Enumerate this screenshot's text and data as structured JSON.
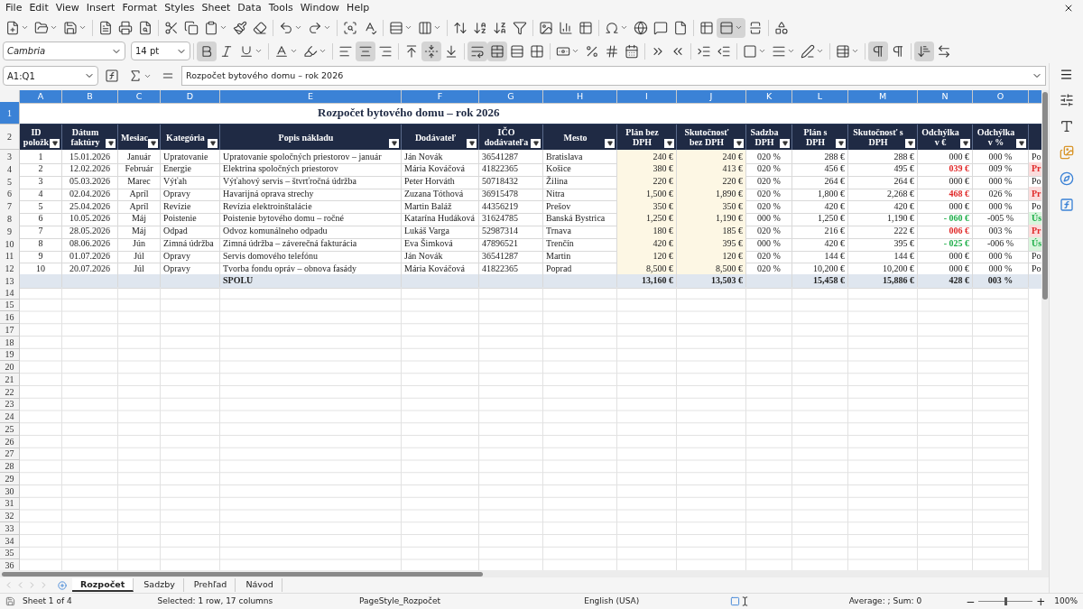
{
  "menu": [
    "File",
    "Edit",
    "View",
    "Insert",
    "Format",
    "Styles",
    "Sheet",
    "Data",
    "Tools",
    "Window",
    "Help"
  ],
  "formatting": {
    "font_name": "Cambria",
    "font_size": "14 pt",
    "pressed": {
      "bold": true,
      "italic": false,
      "underline": false,
      "align_left": false,
      "align_center": true,
      "align_right": false,
      "align_top": false,
      "align_middle": true,
      "align_bottom": false,
      "wrap": true,
      "merge": true,
      "unmerge": false,
      "ltr": true,
      "rtl": false,
      "stacked": true
    }
  },
  "formula_bar": {
    "name_box": "A1:Q1",
    "content": "Rozpočet bytového domu – rok 2026"
  },
  "columns": [
    {
      "label": "A",
      "selected": true
    },
    {
      "label": "B",
      "selected": true
    },
    {
      "label": "C",
      "selected": true
    },
    {
      "label": "D",
      "selected": true
    },
    {
      "label": "E",
      "selected": true
    },
    {
      "label": "F",
      "selected": true
    },
    {
      "label": "G",
      "selected": true
    },
    {
      "label": "H",
      "selected": true
    },
    {
      "label": "I",
      "selected": true
    },
    {
      "label": "J",
      "selected": true
    },
    {
      "label": "K",
      "selected": true
    },
    {
      "label": "L",
      "selected": true
    },
    {
      "label": "M",
      "selected": true
    },
    {
      "label": "N",
      "selected": true
    },
    {
      "label": "O",
      "selected": true
    },
    {
      "selected": true
    }
  ],
  "row_numbers": [
    {
      "label": "1",
      "selected": true
    },
    {
      "label": "2",
      "selected": false
    },
    {
      "label": "3",
      "selected": false
    },
    {
      "label": "4",
      "selected": false
    },
    {
      "label": "5",
      "selected": false
    },
    {
      "label": "6",
      "selected": false
    },
    {
      "label": "7",
      "selected": false
    },
    {
      "label": "8",
      "selected": false
    },
    {
      "label": "9",
      "selected": false
    },
    {
      "label": "10",
      "selected": false
    },
    {
      "label": "11",
      "selected": false
    },
    {
      "label": "12",
      "selected": false
    },
    {
      "label": "13",
      "selected": false
    },
    {
      "label": "14",
      "selected": false
    },
    {
      "label": "15",
      "selected": false
    },
    {
      "label": "16",
      "selected": false
    },
    {
      "label": "17",
      "selected": false
    },
    {
      "label": "18",
      "selected": false
    },
    {
      "label": "19",
      "selected": false
    },
    {
      "label": "20",
      "selected": false
    },
    {
      "label": "21",
      "selected": false
    },
    {
      "label": "22",
      "selected": false
    },
    {
      "label": "23",
      "selected": false
    },
    {
      "label": "24",
      "selected": false
    },
    {
      "label": "25",
      "selected": false
    },
    {
      "label": "26",
      "selected": false
    },
    {
      "label": "27",
      "selected": false
    },
    {
      "label": "28",
      "selected": false
    },
    {
      "label": "29",
      "selected": false
    },
    {
      "label": "30",
      "selected": false
    },
    {
      "label": "31",
      "selected": false
    },
    {
      "label": "32",
      "selected": false
    },
    {
      "label": "33",
      "selected": false
    },
    {
      "label": "34",
      "selected": false
    },
    {
      "label": "35",
      "selected": false
    },
    {
      "label": "36",
      "selected": false
    }
  ],
  "title": "Rozpočet bytového domu – rok 2026",
  "headers": [
    "ID položk",
    "Dátum faktúry",
    "Mesiac",
    "Kategória",
    "Popis nákladu",
    "Dodávateľ",
    "IČO dodávateľa",
    "Mesto",
    "Plán bez DPH",
    "Skutočnosť bez DPH",
    "Sadzba DPH",
    "Plán s DPH",
    "Skutočnosť s DPH",
    "Odchýlka v €",
    "Odchýlka v %"
  ],
  "rows": [
    {
      "kind": "even",
      "cells": [
        "1",
        "15.01.2026",
        "Január",
        "Upratovanie",
        "Upratovanie spoločných priestorov – január",
        "Ján Novák",
        "36541287",
        "Bratislava",
        "240 €",
        "240 €",
        "020 %",
        "288 €",
        "288 €",
        "000 €",
        "000 %",
        "Po"
      ]
    },
    {
      "kind": "over",
      "cells": [
        "2",
        "12.02.2026",
        "Február",
        "Energie",
        "Elektrina spoločných priestorov",
        "Mária Kováčová",
        "41822365",
        "Košice",
        "380 €",
        "413 €",
        "020 %",
        "456 €",
        "495 €",
        "039 €",
        "009 %",
        "Pr"
      ]
    },
    {
      "kind": "even",
      "cells": [
        "3",
        "05.03.2026",
        "Marec",
        "Výťah",
        "Výťahový servis – štvrťročná údržba",
        "Peter Horváth",
        "50718432",
        "Žilina",
        "220 €",
        "220 €",
        "020 %",
        "264 €",
        "264 €",
        "000 €",
        "000 %",
        "Po"
      ]
    },
    {
      "kind": "over",
      "cells": [
        "4",
        "02.04.2026",
        "Apríl",
        "Opravy",
        "Havarijná oprava strechy",
        "Zuzana Tóthová",
        "36915478",
        "Nitra",
        "1,500 €",
        "1,890 €",
        "020 %",
        "1,800 €",
        "2,268 €",
        "468 €",
        "026 %",
        "Pr"
      ]
    },
    {
      "kind": "even",
      "cells": [
        "5",
        "25.04.2026",
        "Apríl",
        "Revízie",
        "Revízia elektroinštalácie",
        "Martin Baláž",
        "44356219",
        "Prešov",
        "350 €",
        "350 €",
        "020 %",
        "420 €",
        "420 €",
        "000 €",
        "000 %",
        "Po"
      ]
    },
    {
      "kind": "under",
      "cells": [
        "6",
        "10.05.2026",
        "Máj",
        "Poistenie",
        "Poistenie bytového domu – ročné",
        "Katarína Hudáková",
        "31624785",
        "Banská Bystrica",
        "1,250 €",
        "1,190 €",
        "000 %",
        "1,250 €",
        "1,190 €",
        "- 060 €",
        "-005 %",
        "Ús"
      ]
    },
    {
      "kind": "over",
      "cells": [
        "7",
        "28.05.2026",
        "Máj",
        "Odpad",
        "Odvoz komunálneho odpadu",
        "Lukáš Varga",
        "52987314",
        "Trnava",
        "180 €",
        "185 €",
        "020 %",
        "216 €",
        "222 €",
        "006 €",
        "003 %",
        "Pr"
      ]
    },
    {
      "kind": "under",
      "cells": [
        "8",
        "08.06.2026",
        "Jún",
        "Zimná údržba",
        "Zimná údržba – záverečná fakturácia",
        "Eva Šimková",
        "47896521",
        "Trenčín",
        "420 €",
        "395 €",
        "000 %",
        "420 €",
        "395 €",
        "- 025 €",
        "-006 %",
        "Ús"
      ]
    },
    {
      "kind": "even",
      "cells": [
        "9",
        "01.07.2026",
        "Júl",
        "Opravy",
        "Servis domového telefónu",
        "Ján Novák",
        "36541287",
        "Martin",
        "120 €",
        "120 €",
        "020 %",
        "144 €",
        "144 €",
        "000 €",
        "000 %",
        "Po"
      ]
    },
    {
      "kind": "even",
      "cells": [
        "10",
        "20.07.2026",
        "Júl",
        "Opravy",
        "Tvorba fondu opráv – obnova fasády",
        "Mária Kováčová",
        "41822365",
        "Poprad",
        "8,500 €",
        "8,500 €",
        "020 %",
        "10,200 €",
        "10,200 €",
        "000 €",
        "000 %",
        "Po"
      ]
    }
  ],
  "totals": {
    "E": "SPOLU",
    "I": "13,160 €",
    "J": "13,503 €",
    "L": "15,458 €",
    "M": "15,886 €",
    "N": "428 €",
    "O": "003 %"
  },
  "sheet_tabs": [
    {
      "label": "Rozpočet",
      "selected": true
    },
    {
      "label": "Sadzby",
      "selected": false
    },
    {
      "label": "Prehľad",
      "selected": false
    },
    {
      "label": "Návod",
      "selected": false
    }
  ],
  "status_bar": {
    "sheet": "Sheet 1 of 4",
    "selection": "Selected: 1 row, 17 columns",
    "page_style": "PageStyle_Rozpočet",
    "language": "English (USA)",
    "summary": "Average: ; Sum: 0",
    "zoom_out": "−",
    "zoom_in": "+",
    "zoom": {
      "level": 0.5
    },
    "zoom_percent": "100%"
  }
}
